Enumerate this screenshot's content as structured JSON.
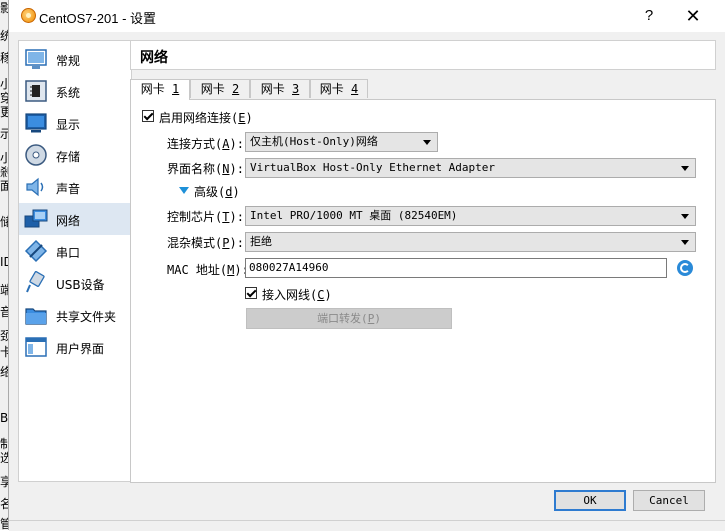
{
  "background_fragments": [
    "影",
    "统",
    "稼",
    "小",
    "穿",
    "更",
    "示",
    "小",
    "剎",
    "面",
    "储",
    "ID",
    "端",
    "音",
    "颈",
    "卡",
    "络",
    "B",
    "制",
    "选",
    "享",
    "名",
    "管"
  ],
  "window": {
    "title": "CentOS7-201 - 设置",
    "help": "?",
    "close": "✕"
  },
  "sidebar": {
    "items": [
      {
        "label": "常规",
        "icon": "general-icon"
      },
      {
        "label": "系统",
        "icon": "system-icon"
      },
      {
        "label": "显示",
        "icon": "display-icon"
      },
      {
        "label": "存储",
        "icon": "storage-icon"
      },
      {
        "label": "声音",
        "icon": "audio-icon"
      },
      {
        "label": "网络",
        "icon": "network-icon",
        "selected": true
      },
      {
        "label": "串口",
        "icon": "serial-icon"
      },
      {
        "label": "USB设备",
        "icon": "usb-icon"
      },
      {
        "label": "共享文件夹",
        "icon": "shared-folder-icon"
      },
      {
        "label": "用户界面",
        "icon": "user-interface-icon"
      }
    ]
  },
  "header": {
    "title": "网络"
  },
  "tabs": [
    {
      "label": "网卡 ",
      "key": "1",
      "active": true
    },
    {
      "label": "网卡 ",
      "key": "2"
    },
    {
      "label": "网卡 ",
      "key": "3"
    },
    {
      "label": "网卡 ",
      "key": "4"
    }
  ],
  "form": {
    "enable": {
      "label": "启用网络连接(",
      "key": "E",
      "suffix": ")",
      "checked": true
    },
    "attached_to": {
      "label": "连接方式(",
      "key": "A",
      "suffix": "):",
      "value": "仅主机(Host-Only)网络"
    },
    "name": {
      "label": "界面名称(",
      "key": "N",
      "suffix": "):",
      "value": "VirtualBox Host-Only Ethernet Adapter"
    },
    "advanced": {
      "label": "高级(",
      "key": "d",
      "suffix": ")"
    },
    "adapter_type": {
      "label": "控制芯片(",
      "key": "T",
      "suffix": "):",
      "value": "Intel PRO/1000 MT 桌面 (82540EM)"
    },
    "promiscuous": {
      "label": "混杂模式(",
      "key": "P",
      "suffix": "):",
      "value": "拒绝"
    },
    "mac": {
      "label": "MAC 地址(",
      "key": "M",
      "suffix": "):",
      "value": "080027A14960"
    },
    "cable": {
      "label": "接入网线(",
      "key": "C",
      "suffix": ")",
      "checked": true
    },
    "port_forward": {
      "label": "端口转发(",
      "key": "P",
      "suffix": ")"
    }
  },
  "buttons": {
    "ok": "OK",
    "cancel": "Cancel"
  }
}
